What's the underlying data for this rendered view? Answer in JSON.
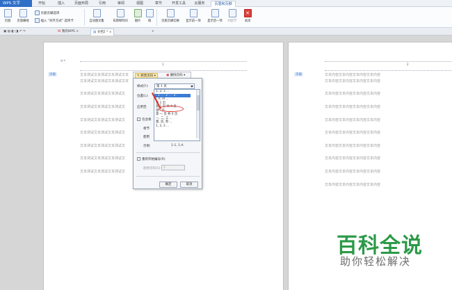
{
  "titlebar": {
    "app_label": "WPS 文字",
    "tabs": [
      "开始",
      "插入",
      "页面布局",
      "引用",
      "审阅",
      "视图",
      "章节",
      "开发工具",
      "云服务",
      "页眉和页脚"
    ]
  },
  "ribbon": {
    "page_label": "页眉",
    "header_label": "页眉横线",
    "same_prev": "页眉页脚选项",
    "insert_align": "插入 \"对齐方式\" 选项卡",
    "auto_text": "自动图文集",
    "date_time": "日期和时间",
    "picture": "图片",
    "field": "域",
    "switch_header": "页眉页脚切换",
    "show_prev": "显示前一项",
    "show_next": "显示后一项",
    "link_prev": "同前节",
    "close": "关闭"
  },
  "tabbar": {
    "tab1": "我的WPS",
    "tab2": "文档2 *"
  },
  "document": {
    "header_num_left": "1",
    "header_num_right": "2",
    "header_tag": "页眉",
    "left_lines": [
      "文本测试文本测试文本测试文本",
      "文本测试文本测试文本测试文本",
      "文本测试文本测试文本测试文",
      "文本测试文本测试文本测试文",
      "文本测试文本测试文本测试文",
      "文本测试文本测试文本测试文",
      "文本测试文本测试文本测试文",
      "文本测试文本测试文本测试文",
      "文本测试文本测试文本测试文"
    ],
    "right_lines": [
      "文本内容文本内容文本内容文本内容",
      "文本内容文本内容文本内容文本内容",
      "文本内容文本内容文本内容文本内容",
      "文本内容文本内容文本内容文本内容",
      "文本内容文本内容文本内容文本内容",
      "文本内容文本内容文本内容文本内容",
      "文本内容文本内容文本内容文本内容",
      "文本内容文本内容文本内容文本内容",
      "文本内容文本内容文本内容文本内容",
      "文本内容文本内容文本内容文本内容"
    ]
  },
  "header_toolbar": {
    "modify_page": "修改页码",
    "delete_page": "删除页码"
  },
  "dialog": {
    "style_label": "样式(F):",
    "style_value": "第 1 页",
    "position_label": "位置(L):",
    "apply_label": "应用范",
    "include_label": "包含章",
    "chapter_label": "章节",
    "use_label": "使用",
    "options": [
      "1, 2, 3 ...",
      "- 1 -, - 2 -, - 3 -",
      "I, II, III ...",
      "第 1 页",
      "第 1 页 共 X 页",
      "第一页",
      "第 一 页 共 X 页",
      "一, 二, 三 ...",
      "壹, 贰, 叁 ...",
      "1, 2, 3 ..."
    ],
    "example_label": "示例:",
    "example_value": "1-1, 1-A",
    "restart_label": "重新开始编号(R)",
    "start_label": "起始页码(S):",
    "start_value": "1",
    "ok": "确定",
    "cancel": "取消"
  },
  "watermark": {
    "title": "百科全说",
    "subtitle": "助你轻松解决"
  }
}
